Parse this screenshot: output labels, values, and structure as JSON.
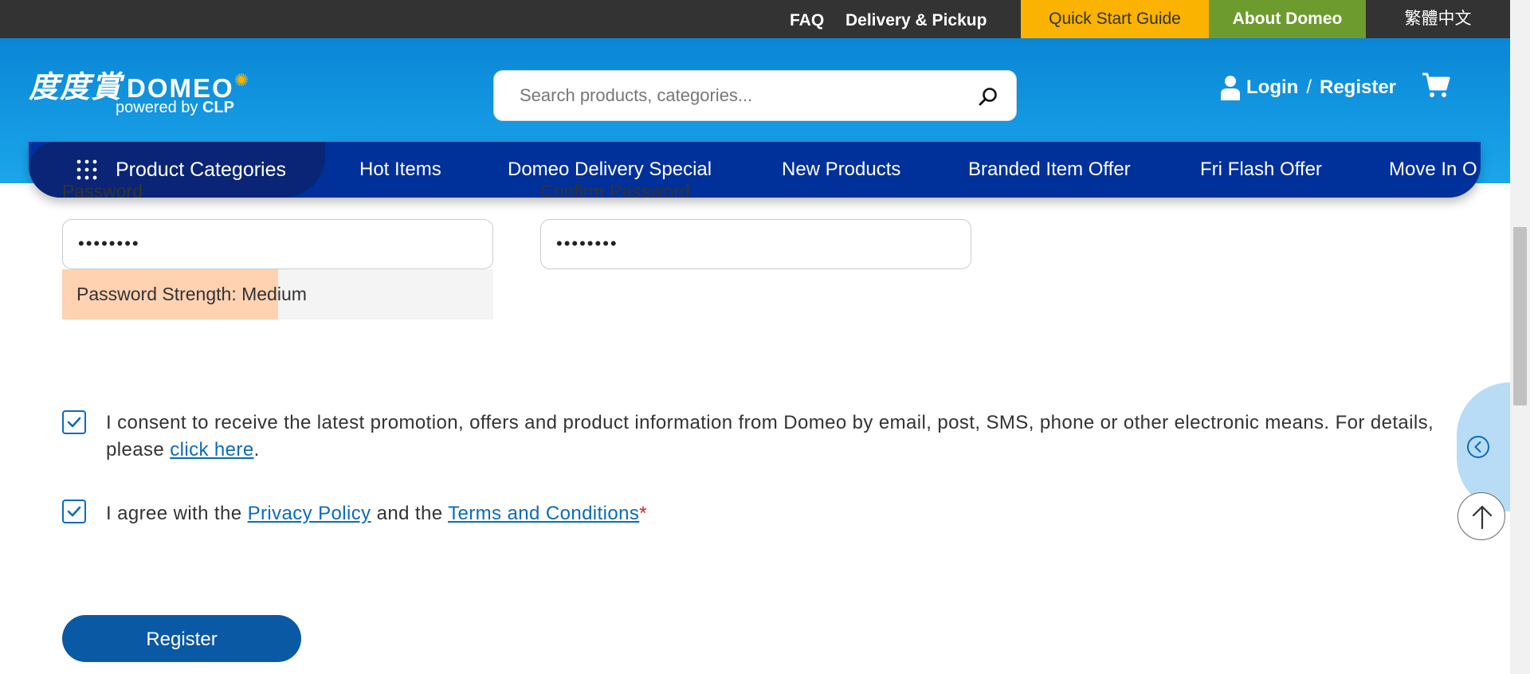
{
  "topbar": {
    "faq": "FAQ",
    "delivery": "Delivery & Pickup",
    "quick_start": "Quick Start Guide",
    "about": "About Domeo",
    "language": "繁體中文"
  },
  "brand": {
    "logo_zh": "度度賞",
    "logo_en": "DOMEO",
    "powered_prefix": "powered by",
    "powered_brand": "CLP"
  },
  "search": {
    "placeholder": "Search products, categories...",
    "icon": "search-icon"
  },
  "account": {
    "login": "Login",
    "separator": "/",
    "register": "Register",
    "user_icon": "user-icon",
    "cart_icon": "cart-icon"
  },
  "nav": {
    "categories": "Product Categories",
    "items": [
      "Hot Items",
      "Domeo Delivery Special",
      "New Products",
      "Branded Item Offer",
      "Fri Flash Offer",
      "Move In O"
    ]
  },
  "form": {
    "password_label": "Password",
    "confirm_label": "Confirm Password",
    "password_value": "••••••••",
    "confirm_value": "••••••••",
    "strength_text": "Password Strength: Medium",
    "strength_fraction": 0.5,
    "strength_color": "#ffd2b2",
    "consent_text": "I consent to receive the latest promotion, offers and product information from Domeo by email, post, SMS, phone or other electronic means. For details, please ",
    "consent_link": "click here",
    "consent_end": ".",
    "consent_checked": true,
    "agree_prefix": "I agree with the ",
    "privacy_link": "Privacy Policy",
    "agree_mid": " and the ",
    "terms_link": "Terms and Conditions",
    "required_mark": "*",
    "agree_checked": true,
    "register_button": "Register"
  },
  "colors": {
    "header_blue": "#0a86d6",
    "nav_blue": "#00309a",
    "accent_yellow": "#f9b300",
    "accent_green": "#6e9b2e",
    "link_blue": "#0b6bbd"
  },
  "floating": {
    "collapse_icon": "chevron-left-circle-icon",
    "back_to_top_icon": "arrow-up-icon"
  }
}
